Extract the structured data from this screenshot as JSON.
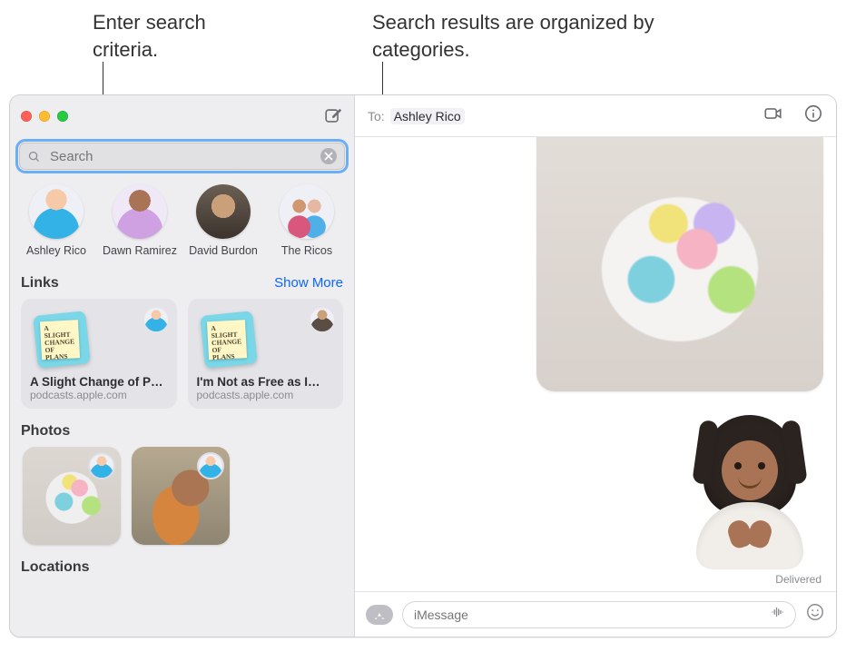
{
  "callouts": {
    "search": "Enter search criteria.",
    "categories": "Search results are organized by categories."
  },
  "sidebar": {
    "search_placeholder": "Search",
    "contacts": [
      {
        "name": "Ashley Rico"
      },
      {
        "name": "Dawn Ramirez"
      },
      {
        "name": "David Burdon"
      },
      {
        "name": "The Ricos"
      }
    ],
    "sections": {
      "links": {
        "title": "Links",
        "show_more": "Show More",
        "items": [
          {
            "title": "A Slight Change of P…",
            "source": "podcasts.apple.com",
            "thumb_text": "A SLIGHT CHANGE OF PLANS"
          },
          {
            "title": "I'm Not as Free as I…",
            "source": "podcasts.apple.com",
            "thumb_text": "A SLIGHT CHANGE OF PLANS"
          }
        ]
      },
      "photos": {
        "title": "Photos"
      },
      "locations": {
        "title": "Locations"
      }
    }
  },
  "conversation": {
    "to_label": "To:",
    "to_name": "Ashley Rico",
    "delivered": "Delivered",
    "input_placeholder": "iMessage"
  },
  "colors": {
    "accent": "#0a66ff",
    "sidebar_bg": "#eeedf0"
  }
}
